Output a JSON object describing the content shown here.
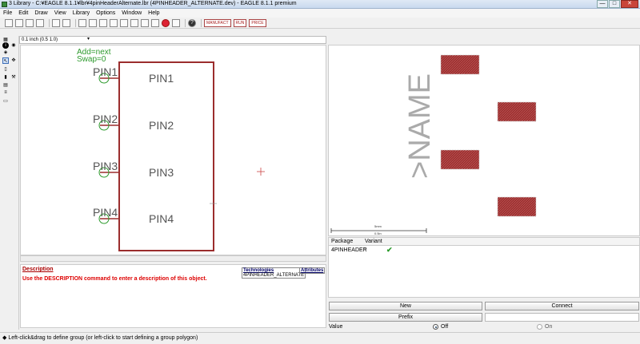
{
  "window": {
    "title": "3 Library - C:¥EAGLE 8.1.1¥lbr¥4pinHeaderAlternate.lbr (4PINHEADER_ALTERNATE.dev) - EAGLE 8.1.1 premium",
    "controls": [
      "—",
      "□",
      "✕"
    ]
  },
  "menu": [
    "File",
    "Edit",
    "Draw",
    "View",
    "Library",
    "Options",
    "Window",
    "Help"
  ],
  "toolbar": {
    "pill_1": "MANUFACT",
    "pill_2": "RUN",
    "pill_3": "PRICE",
    "help_glyph": "?"
  },
  "params": {
    "grid": "0.1 inch (0.5 1.0)",
    "arrow": "▾"
  },
  "symbol": {
    "attributes": [
      "Add=next",
      "Swap=0"
    ],
    "pins": [
      {
        "label": "PIN1",
        "name": "PIN1"
      },
      {
        "label": "PIN2",
        "name": "PIN2"
      },
      {
        "label": "PIN3",
        "name": "PIN3"
      },
      {
        "label": "PIN4",
        "name": "PIN4"
      }
    ]
  },
  "package": {
    "name_text": ">NAME",
    "scale_top": "5mm",
    "scale_bottom": "0.5in"
  },
  "variants": {
    "headers": [
      "Package",
      "Variant"
    ],
    "row": {
      "package": "4PINHEADER",
      "variant": "''"
    }
  },
  "description": {
    "link": "Description",
    "text": "Use the DESCRIPTION command to enter a description of this object.",
    "technologies_header": "Technologies",
    "technologies_value": "4PINHEADER_ALTERNATE",
    "attributes_header": "Attributes"
  },
  "buttons": {
    "new": "New",
    "connect": "Connect",
    "prefix": "Prefix"
  },
  "value_row": {
    "label": "Value",
    "off": "Off",
    "on": "On"
  },
  "status": "◆ Left-click&drag to define group (or left-click to start defining a group polygon)",
  "colors": {
    "symbol_frame": "#9b2d2d",
    "pin_text": "#555555",
    "pin_green": "#2d9a2d",
    "pad_fill": "#9b3030"
  }
}
